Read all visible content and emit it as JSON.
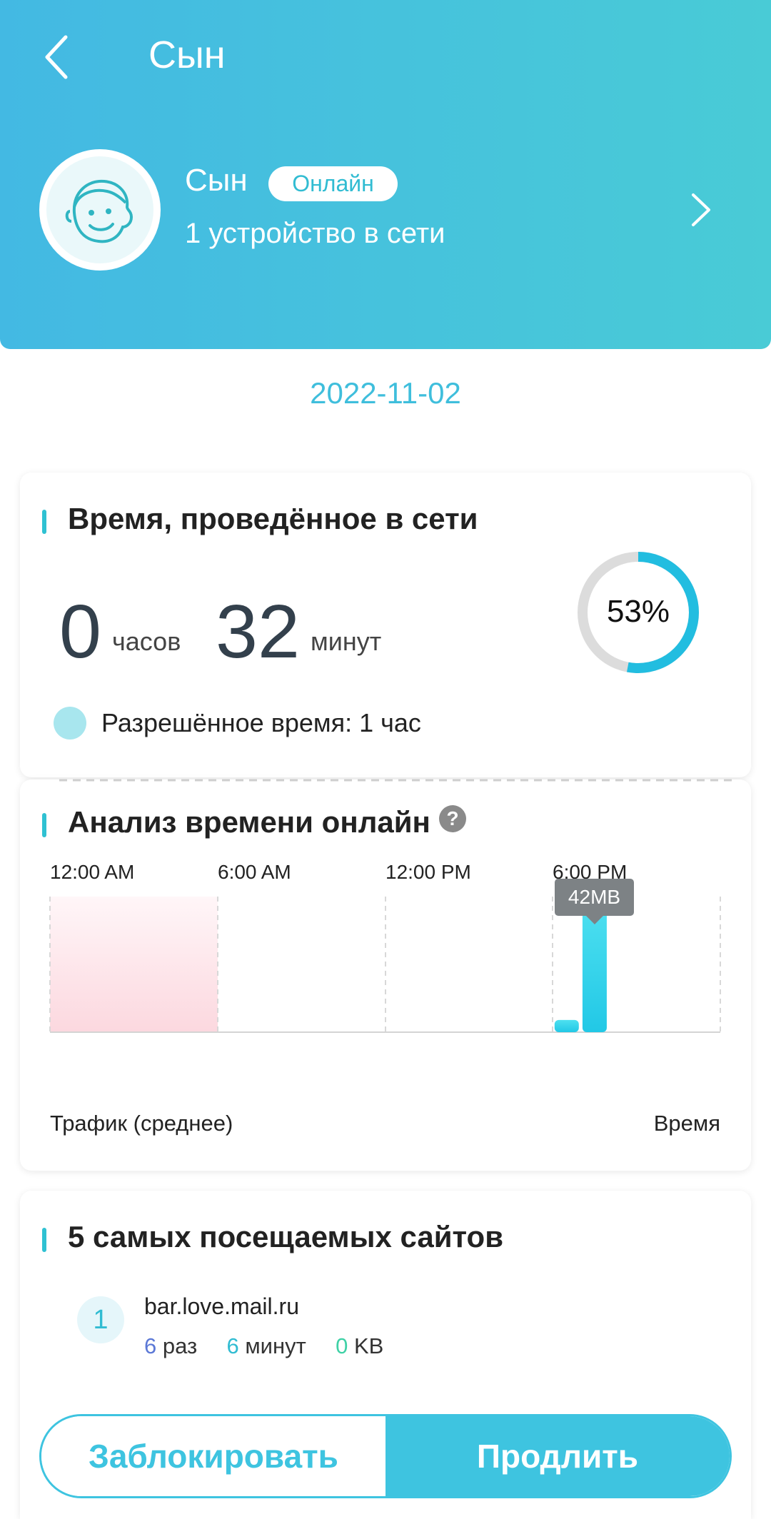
{
  "header": {
    "back_icon": "chevron-left-icon",
    "title": "Сын",
    "profile": {
      "name": "Сын",
      "status": "Онлайн",
      "devices": "1 устройство в сети",
      "avatar_icon": "boy-face-icon"
    },
    "colors": {
      "gradient_start": "#43b9e3",
      "gradient_end": "#49cbd6"
    }
  },
  "date": "2022-11-02",
  "online_time": {
    "title": "Время, проведённое в сети",
    "hours": "0",
    "hours_unit": "часов",
    "minutes": "32",
    "minutes_unit": "минут",
    "percent_label": "53%",
    "percent": 53,
    "allowed": "Разрешённое время: 1 час"
  },
  "analysis": {
    "title": "Анализ времени онлайн",
    "help_icon": "question-icon",
    "tooltip": "42MB",
    "footer_left": "Трафик (среднее)",
    "footer_right": "Время"
  },
  "chart_data": {
    "type": "bar",
    "x_ticks": [
      "12:00 AM",
      "6:00 AM",
      "12:00 PM",
      "6:00 PM"
    ],
    "restricted_period": {
      "from": "12:00 AM",
      "to": "6:00 AM"
    },
    "bars": [
      {
        "x": "6:00 PM",
        "value_mb": 4
      },
      {
        "x": "7:00 PM",
        "value_mb": 42
      }
    ],
    "ylim": [
      0,
      42
    ],
    "highlight_label": "42MB"
  },
  "top_sites": {
    "title": "5 самых посещаемых сайтов",
    "items": [
      {
        "rank": "1",
        "host": "bar.love.mail.ru",
        "visits": "6",
        "visits_unit": "раз",
        "minutes": "6",
        "minutes_unit": "минут",
        "traffic": "0",
        "traffic_unit": "KB"
      }
    ]
  },
  "actions": {
    "block": "Заблокировать",
    "extend": "Продлить"
  }
}
